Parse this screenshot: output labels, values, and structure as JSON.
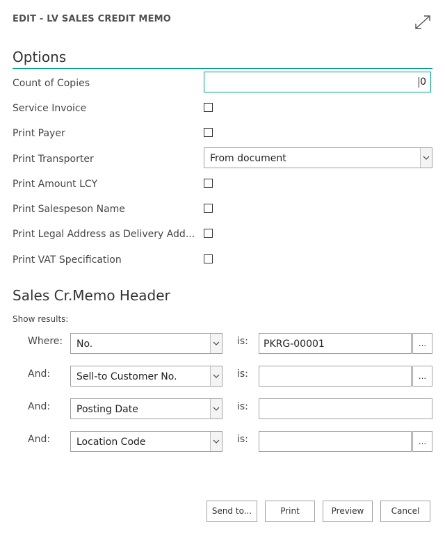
{
  "dialog": {
    "title": "EDIT - LV SALES CREDIT MEMO",
    "expand_icon": "expand-arrows-icon"
  },
  "options": {
    "heading": "Options",
    "count_of_copies": {
      "label": "Count of Copies",
      "value": "0"
    },
    "service_invoice": {
      "label": "Service Invoice",
      "checked": false
    },
    "print_payer": {
      "label": "Print Payer",
      "checked": false
    },
    "print_transporter": {
      "label": "Print Transporter",
      "value": "From document"
    },
    "print_amount_lcy": {
      "label": "Print Amount LCY",
      "checked": false
    },
    "print_salesperson_name": {
      "label": "Print Salespeson Name",
      "checked": false
    },
    "print_legal_address": {
      "label": "Print Legal Address as Delivery Add...",
      "checked": false
    },
    "print_vat_spec": {
      "label": "Print VAT Specification",
      "checked": false
    }
  },
  "filters": {
    "heading": "Sales Cr.Memo Header",
    "subheading": "Show results:",
    "is_label": "is:",
    "rows": [
      {
        "conj": "Where:",
        "field": "No.",
        "value": "PKRG-00001",
        "has_lookup": true
      },
      {
        "conj": "And:",
        "field": "Sell-to Customer No.",
        "value": "",
        "has_lookup": true
      },
      {
        "conj": "And:",
        "field": "Posting Date",
        "value": "",
        "has_lookup": false
      },
      {
        "conj": "And:",
        "field": "Location Code",
        "value": "",
        "has_lookup": true
      }
    ],
    "lookup_label": "..."
  },
  "buttons": {
    "send_to": "Send to...",
    "print": "Print",
    "preview": "Preview",
    "cancel": "Cancel"
  },
  "colors": {
    "accent": "#00a08c",
    "border": "#a0a0a0"
  }
}
